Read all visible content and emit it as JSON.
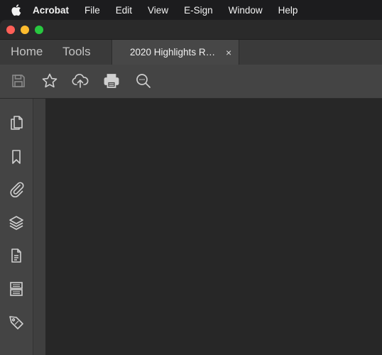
{
  "menubar": {
    "items": [
      "Acrobat",
      "File",
      "Edit",
      "View",
      "E-Sign",
      "Window",
      "Help"
    ]
  },
  "tabs": {
    "home": "Home",
    "tools": "Tools",
    "document": "2020 Highlights R…",
    "close_glyph": "×"
  },
  "colors": {
    "traffic_close": "#ff5f57",
    "traffic_minimize": "#febc2e",
    "traffic_zoom": "#28c840",
    "toolbar_bg": "#444444",
    "doc_bg": "#272727"
  },
  "toolbar": {
    "icons": [
      "save-icon",
      "star-icon",
      "cloud-upload-icon",
      "print-icon",
      "search-more-icon"
    ]
  },
  "sidebar": {
    "icons": [
      "pages-icon",
      "bookmark-icon",
      "attachment-icon",
      "layers-icon",
      "document-icon",
      "compare-icon",
      "tag-icon"
    ]
  }
}
